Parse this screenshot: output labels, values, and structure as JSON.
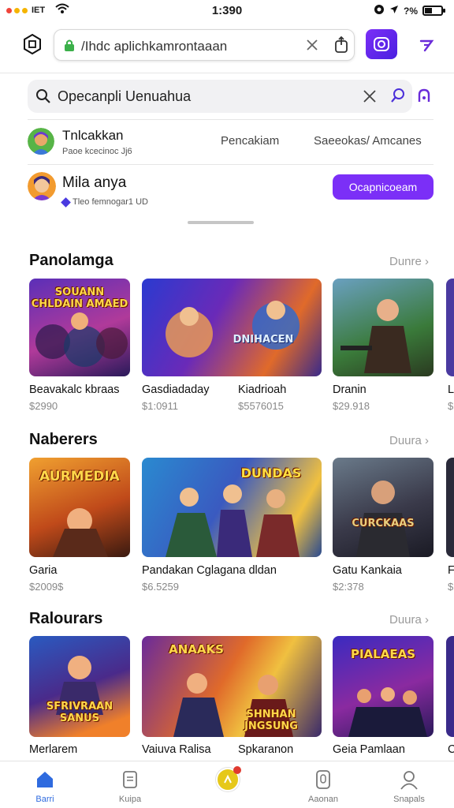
{
  "status_bar": {
    "carrier": "IET",
    "time": "1:390",
    "battery_text": "?%"
  },
  "browser": {
    "url": "/Ihdc aplichkamrontaaan"
  },
  "search": {
    "query": "Opecanpli Uenuahua"
  },
  "accounts": [
    {
      "name": "Tnlcakkan",
      "subtitle": "Paoe kcecinoc Jj6",
      "links": [
        "Pencakiam",
        "Saeeokas/ Amcanes"
      ]
    },
    {
      "name": "Mila anya",
      "subtitle": "Tleo femnogar1 UD",
      "button_label": "Ocapnicoeam"
    }
  ],
  "sections": [
    {
      "title": "Panolamga",
      "more": "Dunre",
      "items": [
        {
          "title": "Beavakalc kbraas",
          "price": "$2990",
          "cover_text": "SOUANN CHLDAIN AMAED"
        },
        {
          "title": "Gasdiadaday",
          "price": "$1:0911",
          "cover_text": "DNIHACEN"
        },
        {
          "title": "Kiadrioah",
          "price": "$5576015",
          "cover_text": ""
        },
        {
          "title": "Dranin",
          "price": "$29.918",
          "cover_text": ""
        },
        {
          "title": "L",
          "price": "$",
          "cover_text": ""
        }
      ]
    },
    {
      "title": "Naberers",
      "more": "Duura",
      "items": [
        {
          "title": "Garia",
          "price": "$2009$",
          "cover_text": "AURMEDIA"
        },
        {
          "title": "Pandakan Cglagana dldan",
          "price": "$6.5259",
          "cover_text": "DUNDAS"
        },
        {
          "title": "Gatu Kankaia",
          "price": "$2:378",
          "cover_text": "CURCKAAS"
        },
        {
          "title": "F",
          "price": "$",
          "cover_text": ""
        }
      ]
    },
    {
      "title": "Ralourars",
      "more": "Duura",
      "items": [
        {
          "title": "Merlarem",
          "price": "",
          "cover_text": "SFRIVRAAN SANUS"
        },
        {
          "title": "Vaiuva Ralisa",
          "price": "",
          "cover_text": "ANAAKS"
        },
        {
          "title": "Spkaranon",
          "price": "",
          "cover_text": "SHNHAN JNGSUNG"
        },
        {
          "title": "Geia Pamlaan",
          "price": "",
          "cover_text": "PIALAEAS"
        },
        {
          "title": "C",
          "price": "",
          "cover_text": ""
        }
      ]
    }
  ],
  "nav": [
    {
      "label": "Barri",
      "icon": "home-icon",
      "active": true
    },
    {
      "label": "Kuipa",
      "icon": "document-icon",
      "active": false
    },
    {
      "label": "",
      "icon": "notifications-icon",
      "active": false
    },
    {
      "label": "Aaonan",
      "icon": "tablet-icon",
      "active": false
    },
    {
      "label": "Snapals",
      "icon": "profile-icon",
      "active": false
    }
  ],
  "colors": {
    "accent": "#7b2ff7",
    "nav_active": "#2f6bdf",
    "badge": "#e6c81a"
  }
}
